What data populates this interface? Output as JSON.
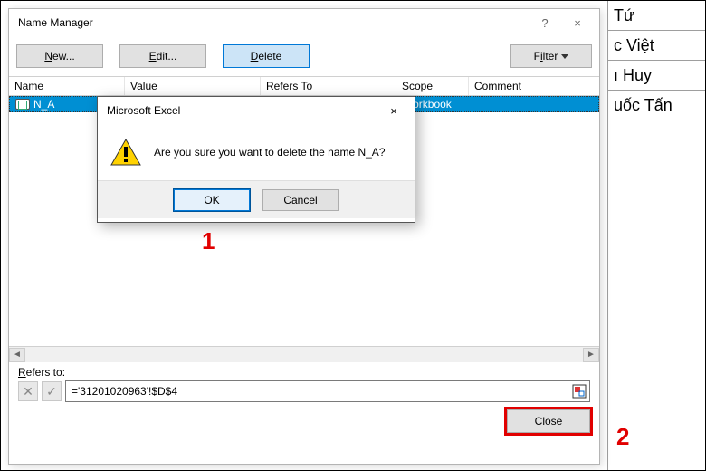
{
  "titlebar": {
    "title": "Name Manager",
    "help": "?",
    "close": "×"
  },
  "toolbar": {
    "new_label": "New...",
    "edit_label": "Edit...",
    "delete_label": "Delete",
    "filter_label": "Filter"
  },
  "columns": {
    "name": "Name",
    "value": "Value",
    "refers": "Refers To",
    "scope": "Scope",
    "comment": "Comment"
  },
  "rows": [
    {
      "name": "N_A",
      "value": "",
      "refers": "",
      "scope": "Workbook",
      "comment": ""
    }
  ],
  "refersto": {
    "label": "Refers to:",
    "formula": "='31201020963'!$D$4"
  },
  "close_label": "Close",
  "msgbox": {
    "title": "Microsoft Excel",
    "text": "Are you sure you want to delete the name N_A?",
    "ok": "OK",
    "cancel": "Cancel",
    "close": "×"
  },
  "annotations": {
    "n1": "1",
    "n2": "2"
  },
  "spreadsheet_cells": [
    " Tứ",
    "c Việt",
    "ı Huy",
    "uốc Tấn"
  ]
}
